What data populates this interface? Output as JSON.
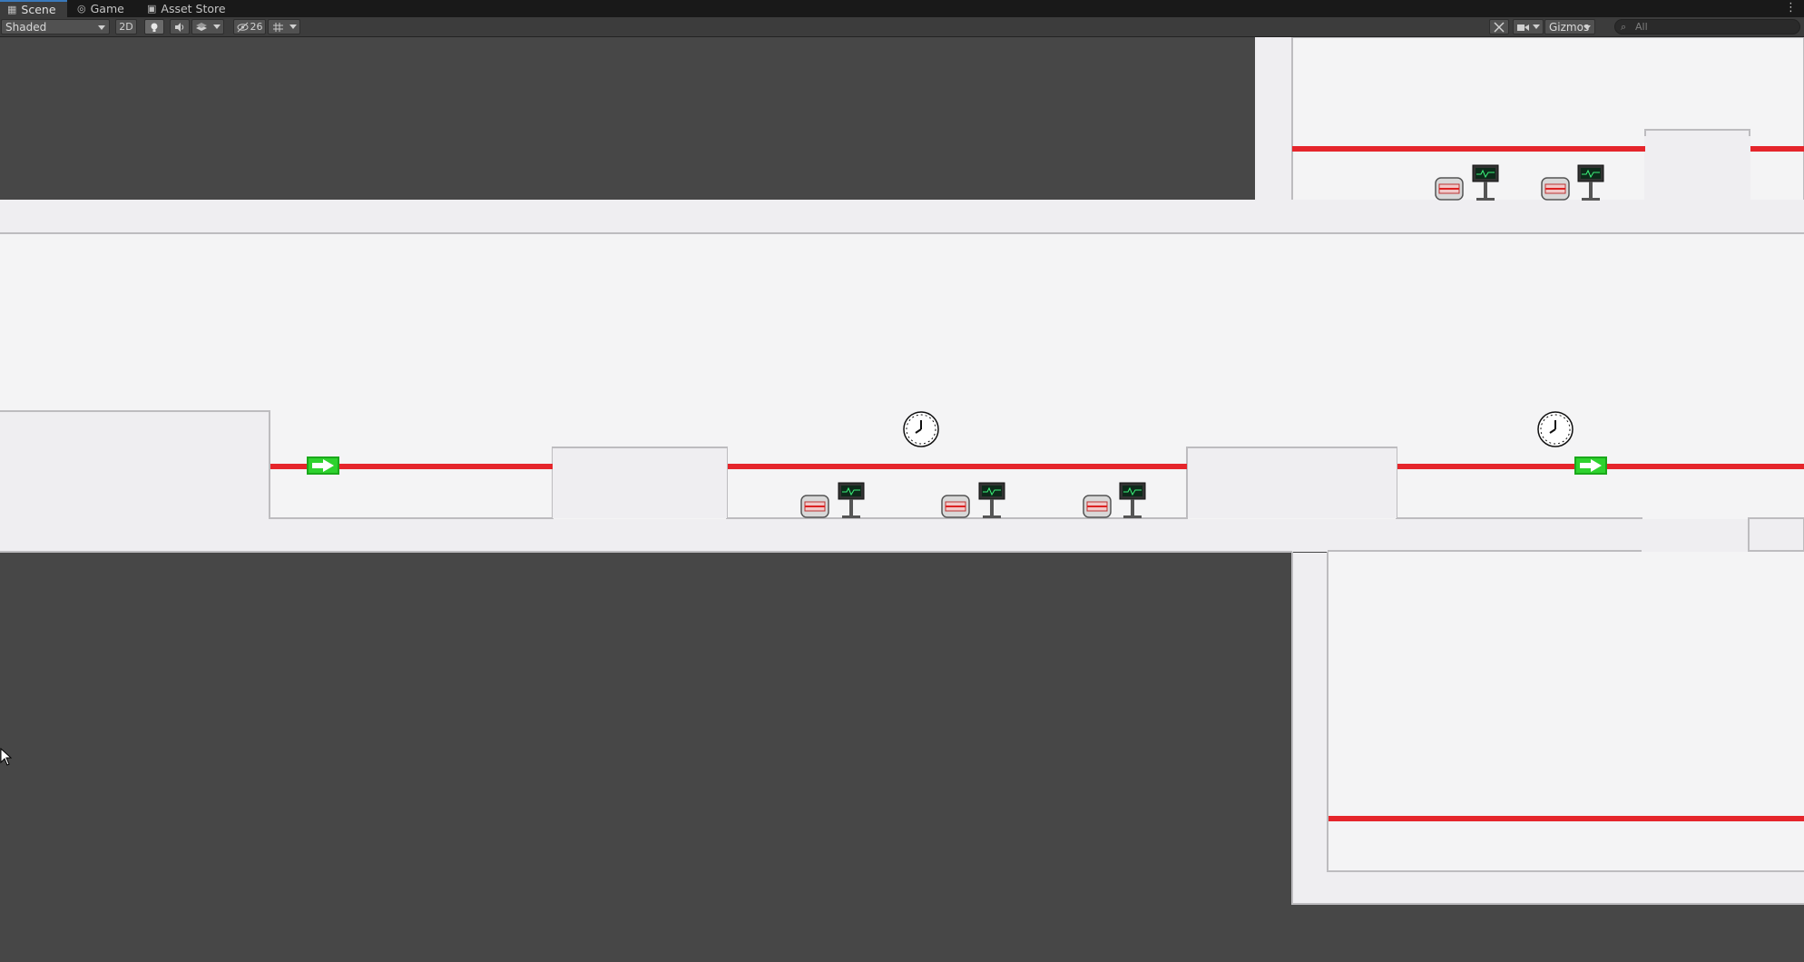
{
  "tabs": [
    {
      "label": "Scene",
      "icon": "grid-icon",
      "active": true
    },
    {
      "label": "Game",
      "icon": "gamepad-icon",
      "active": false
    },
    {
      "label": "Asset Store",
      "icon": "bag-icon",
      "active": false
    }
  ],
  "toolbar": {
    "shading_mode": "Shaded",
    "mode_2d_label": "2D",
    "hidden_count": "26",
    "gizmos_label": "Gizmos",
    "search_placeholder": "All"
  },
  "colors": {
    "background": "#474747",
    "floor": "#f2f1f3",
    "wall_outline": "#bdbcbf",
    "laser": "#e5252b",
    "arrow_sign": "#22cc22",
    "monitor_screen": "#0d2a1a"
  },
  "scene_objects": {
    "clocks": 2,
    "arrow_signs": 2,
    "beds_with_monitors": 5
  }
}
